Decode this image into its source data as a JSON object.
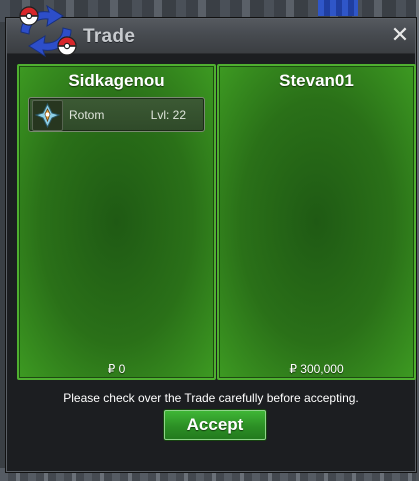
{
  "window": {
    "title": "Trade",
    "close_label": "✕",
    "logo_icon": "trade-swap-pokeball-icon"
  },
  "left_panel": {
    "name": "Sidkagenou",
    "money": "₽ 0",
    "items": [
      {
        "name": "Rotom",
        "level": "Lvl: 22",
        "icon": "rotom-icon"
      }
    ]
  },
  "right_panel": {
    "name": "Stevan01",
    "money": "₽ 300,000",
    "items": []
  },
  "footer": {
    "notice": "Please check over the Trade carefully before accepting.",
    "accept_label": "Accept"
  },
  "colors": {
    "panel_green": "#2a7018",
    "panel_border": "#4fb030",
    "accept_green": "#2c8f25",
    "titlebar": "#474b50"
  }
}
